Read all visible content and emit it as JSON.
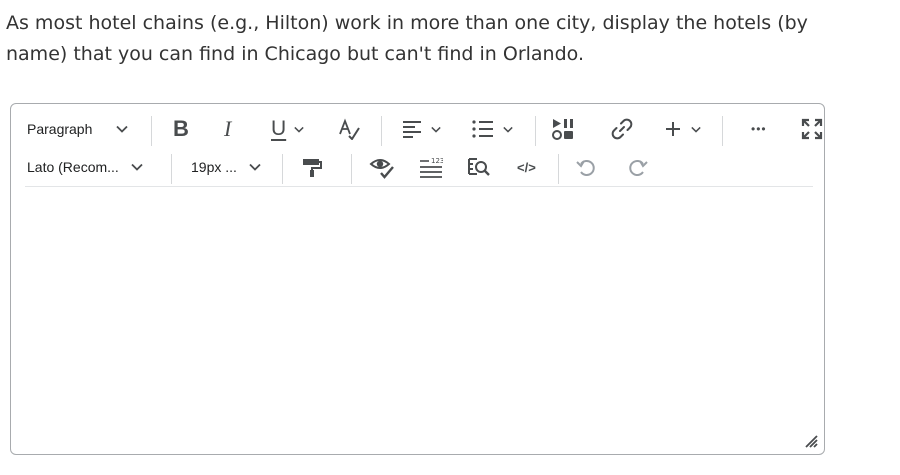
{
  "question": {
    "line1": "As most hotel chains (e.g., Hilton) work in more than one city, display the hotels (by",
    "line2": "name) that you can find in Chicago but can't find in Orlando."
  },
  "toolbar": {
    "paragraph_label": "Paragraph",
    "font_family_label": "Lato (Recom...",
    "font_size_label": "19px ..."
  },
  "icons": {
    "bold": "B",
    "italic": "I",
    "underline": "U",
    "more": "•••",
    "source": "</>"
  },
  "editor": {
    "content": ""
  }
}
